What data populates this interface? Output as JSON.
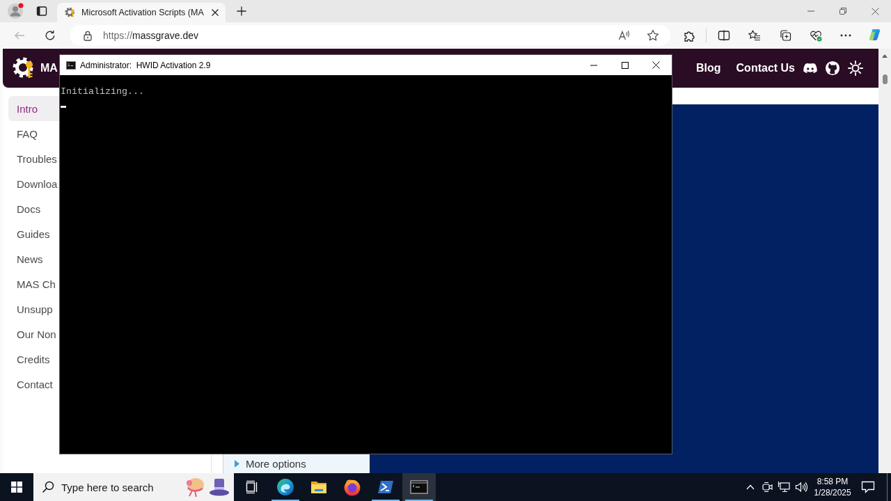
{
  "browser": {
    "profile": {
      "notification": true
    },
    "tabs": [
      {
        "title": "Microsoft Activation Scripts (MA",
        "selected": true
      }
    ],
    "back_button": {
      "disabled": true
    },
    "address_bar": {
      "url": "https://massgrave.dev"
    }
  },
  "site": {
    "logo_text": "MA",
    "nav": [
      "Blog",
      "Contact Us"
    ],
    "sidebar": [
      {
        "label": "Intro",
        "selected": true
      },
      {
        "label": "FAQ",
        "selected": false
      },
      {
        "label": "Troubles",
        "selected": false
      },
      {
        "label": "Downloa",
        "selected": false
      },
      {
        "label": "Docs",
        "selected": false
      },
      {
        "label": "Guides",
        "selected": false
      },
      {
        "label": "News",
        "selected": false
      },
      {
        "label": "MAS Ch",
        "selected": false
      },
      {
        "label": "Unsupp",
        "selected": false
      },
      {
        "label": "Our Non",
        "selected": false
      },
      {
        "label": "Credits",
        "selected": false
      },
      {
        "label": "Contact",
        "selected": false
      }
    ],
    "more_options": {
      "label": "More options",
      "expanded": false
    }
  },
  "console": {
    "title": "Administrator:  HWID Activation 2.9",
    "lines": [
      "Initializing..."
    ],
    "cursor": true
  },
  "taskbar": {
    "search": {
      "placeholder": "Type here to search"
    },
    "apps": [
      {
        "kind": "task-view",
        "selected": false,
        "running": false
      },
      {
        "kind": "edge",
        "selected": false,
        "running": true
      },
      {
        "kind": "explorer",
        "selected": false,
        "running": false
      },
      {
        "kind": "firefox",
        "selected": false,
        "running": false
      },
      {
        "kind": "powershell",
        "selected": false,
        "running": true
      },
      {
        "kind": "terminal",
        "selected": true,
        "running": true
      }
    ],
    "clock": {
      "time": "8:58 PM",
      "date": "1/28/2025"
    }
  }
}
